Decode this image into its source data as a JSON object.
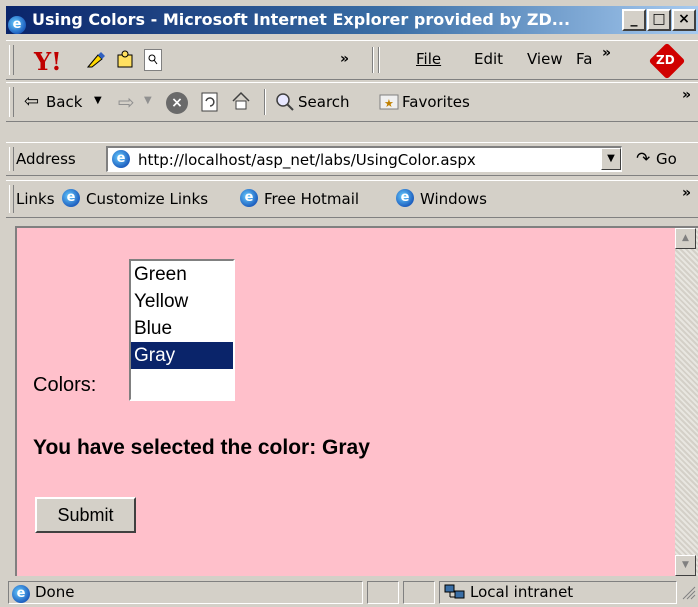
{
  "window": {
    "title": "Using Colors - Microsoft Internet Explorer provided by ZD...",
    "minimize_label": "_",
    "maximize_label": "□",
    "close_label": "×"
  },
  "toolbar1": {
    "chevron": "»",
    "menus": [
      "File",
      "Edit",
      "View",
      "Fa"
    ],
    "menu_chevron": "»",
    "zd_logo": "ZD"
  },
  "toolbar2": {
    "back_label": "Back",
    "search_label": "Search",
    "favorites_label": "Favorites",
    "chevron": "»"
  },
  "address": {
    "label": "Address",
    "url": "http://localhost/asp_net/labs/UsingColor.aspx",
    "go_label": "Go"
  },
  "links": {
    "label": "Links",
    "items": [
      "Customize Links",
      "Free Hotmail",
      "Windows"
    ],
    "chevron": "»"
  },
  "page": {
    "background_color": "#ffc0cb",
    "colors_label": "Colors:",
    "options": [
      "Green",
      "Yellow",
      "Blue",
      "Gray"
    ],
    "selected_option": "Gray",
    "selection_message": "You have selected the color: Gray",
    "submit_label": "Submit"
  },
  "status": {
    "text": "Done",
    "zone": "Local intranet"
  }
}
